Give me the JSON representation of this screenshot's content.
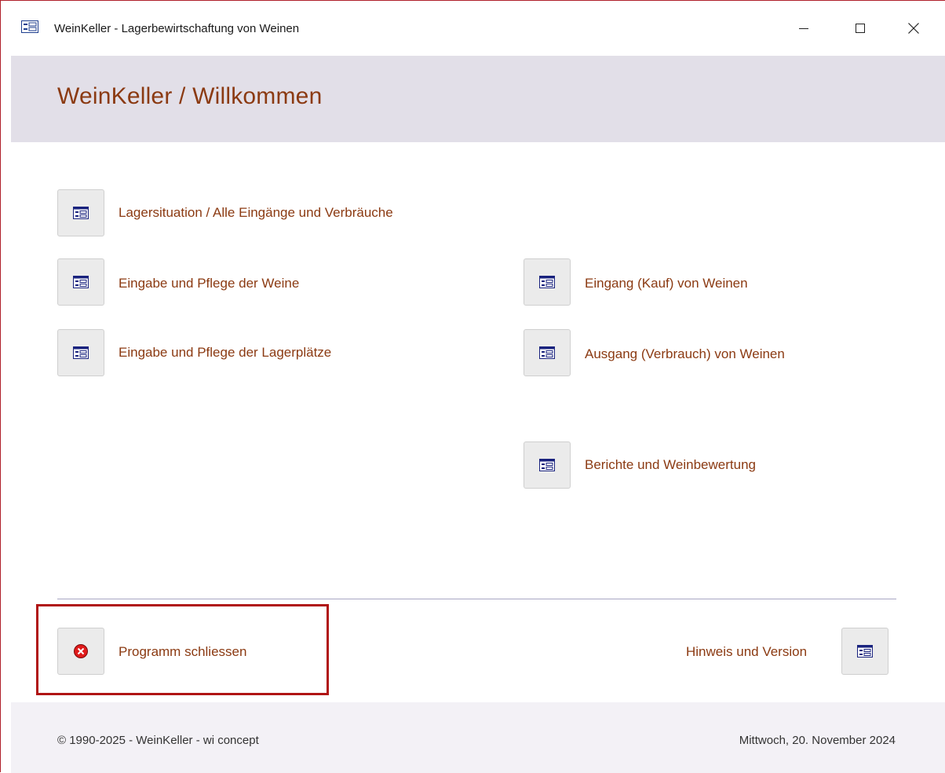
{
  "window": {
    "title": "WeinKeller - Lagerbewirtschaftung von Weinen",
    "minimize_symbol": "—",
    "maximize_symbol": "☐",
    "close_symbol": "✕"
  },
  "header": {
    "title": "WeinKeller / Willkommen"
  },
  "menu": {
    "lagersituation": "Lagersituation / Alle Eingänge und Verbräuche",
    "weine": "Eingabe und Pflege der Weine",
    "lagerplaetze": "Eingabe und Pflege der Lagerplätze",
    "eingang": "Eingang (Kauf) von Weinen",
    "ausgang": "Ausgang (Verbrauch) von Weinen",
    "berichte": "Berichte und Weinbewertung"
  },
  "bottom": {
    "close_program": "Programm schliessen",
    "info_version": "Hinweis und Version"
  },
  "footer": {
    "copyright": "© 1990-2025 - WeinKeller - wi concept",
    "date": "Mittwoch, 20. November 2024"
  },
  "colors": {
    "accent_text": "#8b3a12",
    "header_bg": "#e2dfe8",
    "footer_bg": "#f3f1f6",
    "highlight_border": "#b01414",
    "window_border": "#b0202a"
  },
  "icons": {
    "form": "form-icon",
    "close": "close-circle-icon"
  }
}
